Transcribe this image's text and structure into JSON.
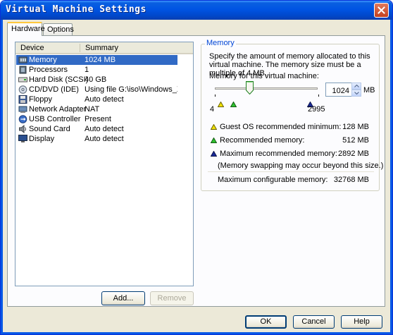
{
  "window": {
    "title": "Virtual Machine Settings"
  },
  "tabs": [
    {
      "label": "Hardware",
      "active": true
    },
    {
      "label": "Options",
      "active": false
    }
  ],
  "device_list": {
    "columns": [
      "Device",
      "Summary"
    ],
    "rows": [
      {
        "device": "Memory",
        "summary": "1024 MB",
        "icon": "memory-icon",
        "selected": true
      },
      {
        "device": "Processors",
        "summary": "1",
        "icon": "processor-icon",
        "selected": false
      },
      {
        "device": "Hard Disk (SCSI)",
        "summary": "40 GB",
        "icon": "hard-disk-icon",
        "selected": false
      },
      {
        "device": "CD/DVD (IDE)",
        "summary": "Using file G:\\iso\\Windows_XP...",
        "icon": "cd-dvd-icon",
        "selected": false
      },
      {
        "device": "Floppy",
        "summary": "Auto detect",
        "icon": "floppy-icon",
        "selected": false
      },
      {
        "device": "Network Adapter",
        "summary": "NAT",
        "icon": "network-adapter-icon",
        "selected": false
      },
      {
        "device": "USB Controller",
        "summary": "Present",
        "icon": "usb-icon",
        "selected": false
      },
      {
        "device": "Sound Card",
        "summary": "Auto detect",
        "icon": "sound-card-icon",
        "selected": false
      },
      {
        "device": "Display",
        "summary": "Auto detect",
        "icon": "display-icon",
        "selected": false
      }
    ],
    "add_button": "Add...",
    "remove_button": "Remove"
  },
  "memory": {
    "group_label": "Memory",
    "description": "Specify the amount of memory allocated to this virtual machine. The memory size must be a multiple of 4 MB.",
    "field_label": "Memory for this virtual machine:",
    "value": "1024",
    "unit": "MB",
    "slider": {
      "min_label": "4",
      "max_label": "2995",
      "value_mb": 1024
    },
    "guest_min_label": "Guest OS recommended minimum:",
    "guest_min_value": "128 MB",
    "recommended_label": "Recommended memory:",
    "recommended_value": "512 MB",
    "max_recommended_label": "Maximum recommended memory:",
    "max_recommended_value": "2892 MB",
    "note": "(Memory swapping may occur beyond this size.)",
    "max_configurable_label": "Maximum configurable memory:",
    "max_configurable_value": "32768 MB",
    "marker_colors": {
      "guest_min": "#f0e000",
      "recommended": "#2ec22e",
      "max_recommended": "#1a2a9a"
    }
  },
  "footer": {
    "ok": "OK",
    "cancel": "Cancel",
    "help": "Help"
  },
  "colors": {
    "titlebar": "#0054e3",
    "selection": "#316ac5",
    "group_label": "#0046d5",
    "dialog_bg": "#ece9d8"
  }
}
